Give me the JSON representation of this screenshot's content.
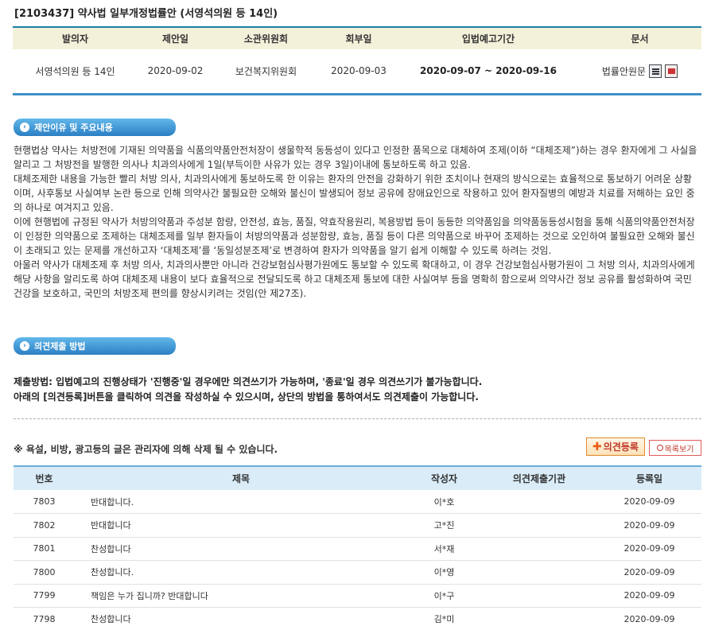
{
  "page_title": "[2103437] 약사법 일부개정법률안 (서영석의원 등 14인)",
  "info": {
    "headers": [
      "발의자",
      "제안일",
      "소관위원회",
      "회부일",
      "입법예고기간",
      "문서"
    ],
    "proposer": "서영석의원 등 14인",
    "propose_date": "2020-09-02",
    "committee": "보건복지위원회",
    "refer_date": "2020-09-03",
    "period": "2020-09-07 ~ 2020-09-16",
    "doc_label": "법률안원문"
  },
  "reason_section": {
    "badge": "제안이유 및 주요내용",
    "paragraphs": [
      "현행법상 약사는 처방전에 기재된 의약품을 식품의약품안전처장이 생물학적 동등성이 있다고 인정한 품목으로 대체하여 조제(이하 “대체조제”)하는 경우 환자에게 그 사실을 알리고 그 처방전을 발행한 의사나 치과의사에게 1일(부득이한 사유가 있는 경우 3일)이내에 통보하도록 하고 있음.",
      "대체조제한 내용을 가능한 빨리 처방 의사, 치과의사에게 통보하도록 한 이유는 환자의 안전을 강화하기 위한 조치이나 현재의 방식으로는 효율적으로 통보하기 어려운 상황이며, 사후통보 사실여부 논란 등으로 인해 의약사간 불필요한 오해와 불신이 발생되어 정보 공유에 장애요인으로 작용하고 있어 환자질병의 예방과 치료를 저해하는 요인 중의 하나로 여겨지고 있음.",
      "이에 현행법에 규정된 약사가 처방의약품과 주성분 함량, 안전성, 효능, 품질, 약효작용원리, 복용방법 등이 동등한 의약품임을 의약품동등성시험을 통해 식품의약품안전처장이 인정한 의약품으로 조제하는 대체조제를 일부 환자들이 처방의약품과 성분함량, 효능, 품질 등이 다른 의약품으로 바꾸어 조제하는 것으로 오인하여 불필요한 오해와 불신이 초래되고 있는 문제를 개선하고자 ‘대체조제’를 ‘동일성분조제’로 변경하여 환자가 의약품을 알기 쉽게 이해할 수 있도록 하려는 것임.",
      "아울러 약사가 대체조제 후 처방 의사, 치과의사뿐만 아니라 건강보험심사평가원에도 통보할 수 있도록 확대하고, 이 경우 건강보험심사평가원이 그 처방 의사, 치과의사에게 해당 사항을 알리도록 하여 대체조제 내용이 보다 효율적으로 전달되도록 하고 대체조제 통보에 대한 사실여부 등을 명확히 함으로써 의약사간 정보 공유를 활성화하여 국민건강을 보호하고, 국민의 처방조제 편의를 향상시키려는 것임(안 제27조)."
    ]
  },
  "method_section": {
    "badge": "의견제출 방법",
    "line1": "제출방법: 입법예고의 진행상태가 '진행중'일 경우에만 의견쓰기가 가능하며, '종료'일 경우 의견쓰기가 불가능합니다.",
    "line2": "아래의 [의견등록]버튼을 클릭하여 의견을 작성하실 수 있으시며, 상단의 방법을 통하여서도 의견제출이 가능합니다."
  },
  "notice": "※ 욕설, 비방, 광고등의 글은 관리자에 의해 삭제 될 수 있습니다.",
  "buttons": {
    "register": "의견등록",
    "list": "목록보기"
  },
  "opinions": {
    "headers": [
      "번호",
      "제목",
      "작성자",
      "의견제출기관",
      "등록일"
    ],
    "rows": [
      {
        "no": "7803",
        "subject": "반대합니다.",
        "author": "이*호",
        "org": "",
        "date": "2020-09-09"
      },
      {
        "no": "7802",
        "subject": "반대합니다",
        "author": "고*진",
        "org": "",
        "date": "2020-09-09"
      },
      {
        "no": "7801",
        "subject": "찬성합니다",
        "author": "서*재",
        "org": "",
        "date": "2020-09-09"
      },
      {
        "no": "7800",
        "subject": "찬성합니다.",
        "author": "이*영",
        "org": "",
        "date": "2020-09-09"
      },
      {
        "no": "7799",
        "subject": "책임은 누가 집니까? 반대합니다",
        "author": "이*구",
        "org": "",
        "date": "2020-09-09"
      },
      {
        "no": "7798",
        "subject": "찬성합니다",
        "author": "김*미",
        "org": "",
        "date": "2020-09-09"
      }
    ]
  }
}
